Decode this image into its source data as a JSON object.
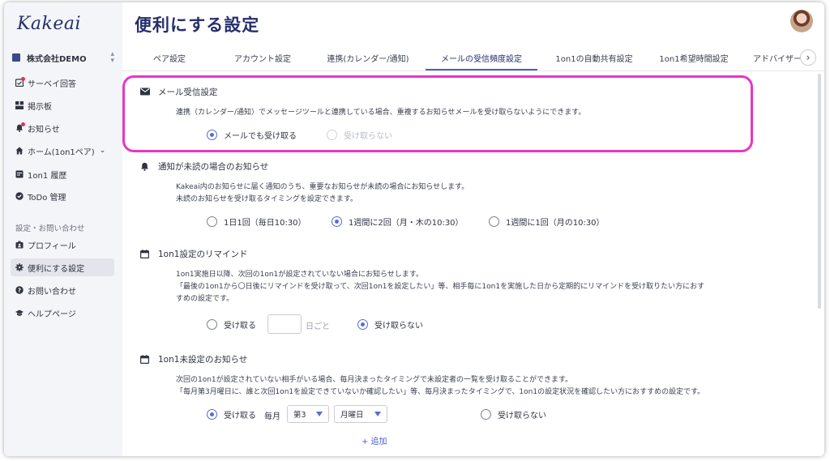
{
  "app": {
    "logo": "Kakeai",
    "company": "株式会社DEMO"
  },
  "sidebar": {
    "items": [
      {
        "label": "サーベイ回答"
      },
      {
        "label": "掲示板"
      },
      {
        "label": "お知らせ"
      },
      {
        "label": "ホーム(1on1ペア)"
      },
      {
        "label": "1on1 履歴"
      },
      {
        "label": "ToDo 管理"
      }
    ],
    "section_label": "設定・お問い合わせ",
    "settings_items": [
      {
        "label": "プロフィール"
      },
      {
        "label": "便利にする設定"
      },
      {
        "label": "お問い合わせ"
      },
      {
        "label": "ヘルプページ"
      }
    ]
  },
  "page": {
    "title": "便利にする設定"
  },
  "tabs": [
    {
      "label": "ペア設定"
    },
    {
      "label": "アカウント設定"
    },
    {
      "label": "連携(カレンダー/通知)"
    },
    {
      "label": "メールの受信頻度設定"
    },
    {
      "label": "1on1の自動共有設定"
    },
    {
      "label": "1on1希望時間設定"
    },
    {
      "label": "アドバイザー"
    }
  ],
  "sections": {
    "mail": {
      "title": "メール受信設定",
      "desc": "連携（カレンダー/通知）でメッセージツールと連携している場合、重複するお知らせメールを受け取らないようにできます。",
      "options": [
        "メールでも受け取る",
        "受け取らない"
      ]
    },
    "unread": {
      "title": "通知が未読の場合のお知らせ",
      "desc1": "Kakeai内のお知らせに届く通知のうち、重要なお知らせが未読の場合にお知らせします。",
      "desc2": "未読のお知らせを受け取るタイミングを設定できます。",
      "options": [
        "1日1回（毎日10:30）",
        "1週間に2回（月・木の10:30）",
        "1週間に1回（月の10:30）"
      ]
    },
    "remind": {
      "title": "1on1設定のリマインド",
      "desc1": "1on1実施日以降、次回の1on1が設定されていない場合にお知らせします。",
      "desc2": "「最後の1on1から〇日後にリマインドを受け取って、次回1on1を設定したい」等、相手毎に1on1を実施した日から定期的にリマインドを受け取りたい方におす",
      "desc3": "すめの設定です。",
      "option_receive": "受け取る",
      "unit": "日ごと",
      "option_none": "受け取らない"
    },
    "unset": {
      "title": "1on1未設定のお知らせ",
      "desc1": "次回の1on1が設定されていない相手がいる場合、毎月決まったタイミングで未設定者の一覧を受け取ることができます。",
      "desc2": "「毎月第3月曜日に、誰と次回1on1を設定できていないか確認したい」等、毎月決まったタイミングで、1on1の設定状況を確認したい方におすすめの設定です。",
      "option_receive": "受け取る",
      "monthly": "毎月",
      "week_select": "第3",
      "day_select": "月曜日",
      "option_none": "受け取らない",
      "add": "+ 追加"
    }
  },
  "colors": {
    "accent": "#5b6ad6",
    "brand": "#262f6b",
    "highlight": "#e637c4"
  }
}
